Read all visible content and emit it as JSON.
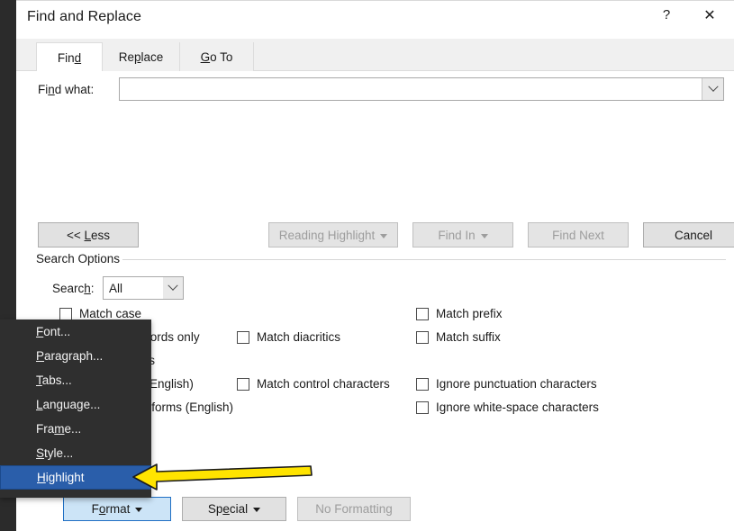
{
  "window": {
    "title": "Find and Replace",
    "help_label": "?",
    "close_label": "✕"
  },
  "tabs": [
    {
      "label": "Find",
      "active": true
    },
    {
      "label": "Replace",
      "active": false
    },
    {
      "label": "Go To",
      "active": false
    }
  ],
  "find_panel": {
    "find_what_label": "Find what:",
    "find_what_value": "",
    "find_what_placeholder": ""
  },
  "action_buttons": [
    {
      "label": "<< Less",
      "enabled": true,
      "has_caret": false
    },
    {
      "label": "Reading Highlight",
      "enabled": false,
      "has_caret": true
    },
    {
      "label": "Find In",
      "enabled": false,
      "has_caret": true
    },
    {
      "label": "Find Next",
      "enabled": false,
      "has_caret": false
    },
    {
      "label": "Cancel",
      "enabled": true,
      "has_caret": false
    }
  ],
  "search_options": {
    "group_label": "Search Options",
    "search_label": "Search:",
    "search_value": "All",
    "column_left": [
      {
        "label": "Match case",
        "checked": false
      },
      {
        "label": "Find whole words only",
        "checked": false
      },
      {
        "label": "Use wildcards",
        "checked": false
      },
      {
        "label": "Sounds like (English)",
        "checked": false
      },
      {
        "label": "Find all word forms (English)",
        "checked": false
      }
    ],
    "column_middle": [
      {
        "label": "Match diacritics",
        "checked": false
      },
      {
        "label": "Match control characters",
        "checked": false
      }
    ],
    "column_right": [
      {
        "label": "Match prefix",
        "checked": false
      },
      {
        "label": "Match suffix",
        "checked": false
      },
      {
        "label": "Ignore punctuation characters",
        "checked": false
      },
      {
        "label": "Ignore white-space characters",
        "checked": false
      }
    ]
  },
  "bottom_buttons": {
    "format_label": "Format",
    "special_label": "Special",
    "no_formatting_label": "No Formatting"
  },
  "context_menu": {
    "items": [
      {
        "label": "Font...",
        "selected": false
      },
      {
        "label": "Paragraph...",
        "selected": false
      },
      {
        "label": "Tabs...",
        "selected": false
      },
      {
        "label": "Language...",
        "selected": false
      },
      {
        "label": "Frame...",
        "selected": false
      },
      {
        "label": "Style...",
        "selected": false
      },
      {
        "label": "Highlight",
        "selected": true
      }
    ]
  },
  "annotation": {
    "arrow_color": "#ffe400",
    "arrow_outline": "#000000",
    "points_to": "Highlight"
  },
  "colors": {
    "selection_blue": "#2a5eaa",
    "menu_background": "#2f2f2f",
    "active_button_blue": "#cce4f7",
    "button_face": "#e1e1e1"
  }
}
